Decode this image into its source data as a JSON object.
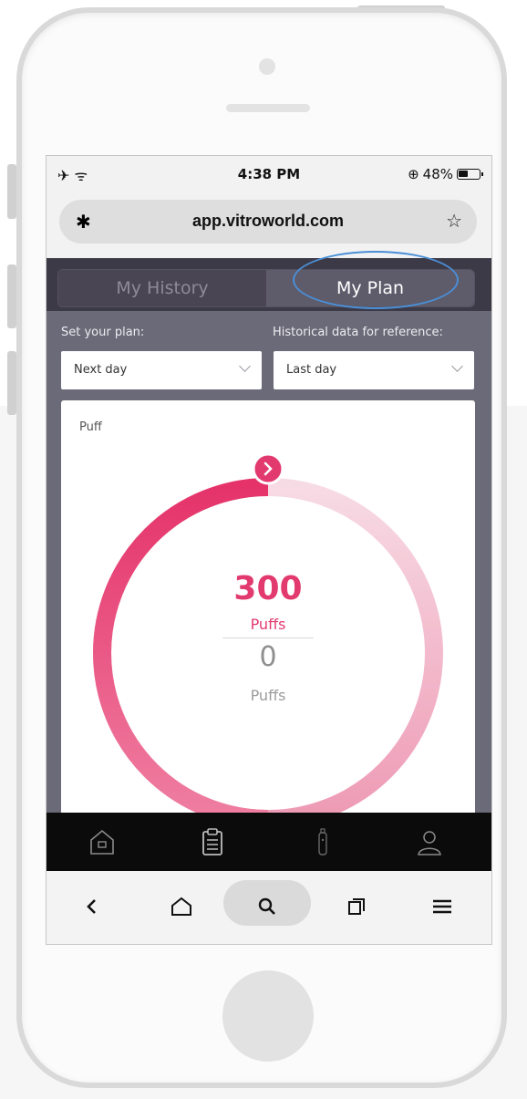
{
  "status": {
    "time": "4:38 PM",
    "battery": "48%",
    "battery_level": 0.48
  },
  "browser": {
    "url": "app.vitroworld.com"
  },
  "segments": {
    "history": "My History",
    "plan": "My Plan",
    "active": "plan"
  },
  "filters": {
    "plan_label": "Set your plan:",
    "plan_value": "Next day",
    "history_label": "Historical data for reference:",
    "history_value": "Last day"
  },
  "card": {
    "title": "Puff",
    "plan_value": "300",
    "plan_unit": "Puffs",
    "actual_value": "0",
    "actual_unit": "Puffs",
    "progress_fraction": 0.5
  },
  "colors": {
    "accent": "#e23a6f",
    "accent_light": "#f6d3df",
    "highlight_ring": "#4a8fd6"
  },
  "icons": {
    "tabbar": [
      "home-icon",
      "clipboard-icon",
      "device-icon",
      "profile-icon"
    ],
    "browser": [
      "back-icon",
      "home-icon",
      "search-icon",
      "tabs-icon",
      "menu-icon"
    ]
  }
}
